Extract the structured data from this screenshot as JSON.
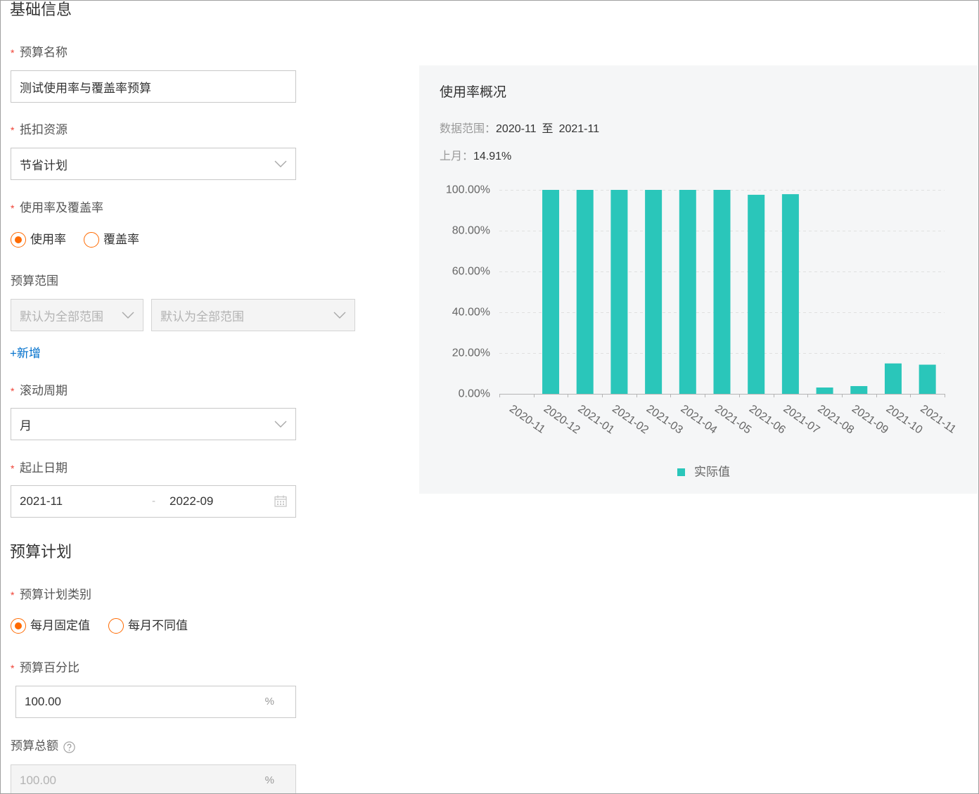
{
  "sections": {
    "basic_info": "基础信息",
    "budget_plan": "预算计划"
  },
  "form": {
    "required_mark": "*",
    "budget_name": {
      "label": "预算名称",
      "value": "测试使用率与覆盖率预算"
    },
    "deduct_resource": {
      "label": "抵扣资源",
      "value": "节省计划"
    },
    "usage_coverage": {
      "label": "使用率及覆盖率",
      "options": [
        {
          "label": "使用率",
          "checked": true
        },
        {
          "label": "覆盖率",
          "checked": false
        }
      ]
    },
    "budget_scope": {
      "label": "预算范围",
      "selects": [
        {
          "placeholder": "默认为全部范围"
        },
        {
          "placeholder": "默认为全部范围"
        }
      ],
      "add_link": "+新增"
    },
    "rolling_period": {
      "label": "滚动周期",
      "value": "月"
    },
    "date_range": {
      "label": "起止日期",
      "start": "2021-11",
      "separator": "-",
      "end": "2022-09"
    },
    "plan_type": {
      "label": "预算计划类别",
      "options": [
        {
          "label": "每月固定值",
          "checked": true
        },
        {
          "label": "每月不同值",
          "checked": false
        }
      ]
    },
    "budget_percent": {
      "label": "预算百分比",
      "value": "100.00",
      "unit": "%"
    },
    "budget_total": {
      "label": "预算总额",
      "value": "100.00",
      "unit": "%",
      "disabled": true
    }
  },
  "chart_panel": {
    "range_label": "数据范围：",
    "range_start": "2020-11",
    "range_separator": "至",
    "range_end": "2021-11",
    "last_month_label": "上月：",
    "last_month_value": "14.91%"
  },
  "chart_data": {
    "type": "bar",
    "title": "使用率概况",
    "categories": [
      "2020-11",
      "2020-12",
      "2021-01",
      "2021-02",
      "2021-03",
      "2021-04",
      "2021-05",
      "2021-06",
      "2021-07",
      "2021-08",
      "2021-09",
      "2021-10",
      "2021-11"
    ],
    "series": [
      {
        "name": "实际值",
        "values": [
          0,
          100,
          100,
          100,
          100,
          100,
          100,
          97.6,
          97.9,
          3.1,
          3.8,
          14.91,
          14.3
        ],
        "color": "#2ac6ba"
      }
    ],
    "ylim": [
      0,
      100
    ],
    "y_ticks": [
      0,
      20,
      40,
      60,
      80,
      100
    ],
    "y_tick_labels": [
      "0.00%",
      "20.00%",
      "40.00%",
      "60.00%",
      "80.00%",
      "100.00%"
    ],
    "xlabel": "",
    "ylabel": "",
    "grid": true,
    "legend_position": "bottom-center"
  },
  "icons": {
    "select_arrow": "chevron-down-icon",
    "calendar": "calendar-icon",
    "help": "question-circle-icon",
    "radio": "radio-icon"
  },
  "colors": {
    "accent": "#ff6a00",
    "required": "#f04134",
    "link": "#0070cc",
    "bar": "#2ac6ba",
    "panel_bg": "#f5f6f7"
  }
}
